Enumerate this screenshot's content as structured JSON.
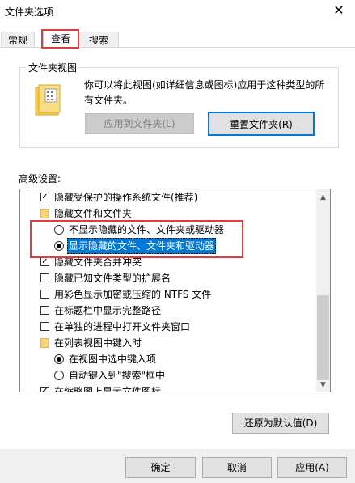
{
  "window": {
    "title": "文件夹选项",
    "close_glyph": "✕"
  },
  "tabs": [
    {
      "label": "常规"
    },
    {
      "label": "查看"
    },
    {
      "label": "搜索"
    }
  ],
  "folder_views": {
    "legend": "文件夹视图",
    "description": "你可以将此视图(如详细信息或图标)应用于这种类型的所有文件夹。",
    "apply_button": "应用到文件夹(L)",
    "reset_button": "重置文件夹(R)"
  },
  "advanced": {
    "label": "高级设置:",
    "items": [
      {
        "kind": "checkbox",
        "checked": true,
        "label": "隐藏受保护的操作系统文件(推荐)"
      },
      {
        "kind": "folder",
        "label": "隐藏文件和文件夹"
      },
      {
        "kind": "radio",
        "selected": false,
        "label": "不显示隐藏的文件、文件夹或驱动器"
      },
      {
        "kind": "radio",
        "selected": true,
        "label": "显示隐藏的文件、文件夹和驱动器"
      },
      {
        "kind": "checkbox",
        "checked": true,
        "label": "隐藏文件夹合并冲突"
      },
      {
        "kind": "checkbox",
        "checked": false,
        "label": "隐藏已知文件类型的扩展名"
      },
      {
        "kind": "checkbox",
        "checked": false,
        "label": "用彩色显示加密或压缩的 NTFS 文件"
      },
      {
        "kind": "checkbox",
        "checked": false,
        "label": "在标题栏中显示完整路径"
      },
      {
        "kind": "checkbox",
        "checked": false,
        "label": "在单独的进程中打开文件夹窗口"
      },
      {
        "kind": "folder",
        "label": "在列表视图中键入时"
      },
      {
        "kind": "radio",
        "selected": true,
        "label": "在视图中选中键入项"
      },
      {
        "kind": "radio",
        "selected": false,
        "label": "自动键入到\"搜索\"框中"
      },
      {
        "kind": "checkbox",
        "checked": true,
        "label": "在缩略图上显示文件图标"
      }
    ],
    "restore_button": "还原为默认值(D)"
  },
  "footer": {
    "ok": "确定",
    "cancel": "取消",
    "apply": "应用(A)"
  },
  "colors": {
    "accent": "#0078d7",
    "annotation_red": "#e33b3b"
  }
}
